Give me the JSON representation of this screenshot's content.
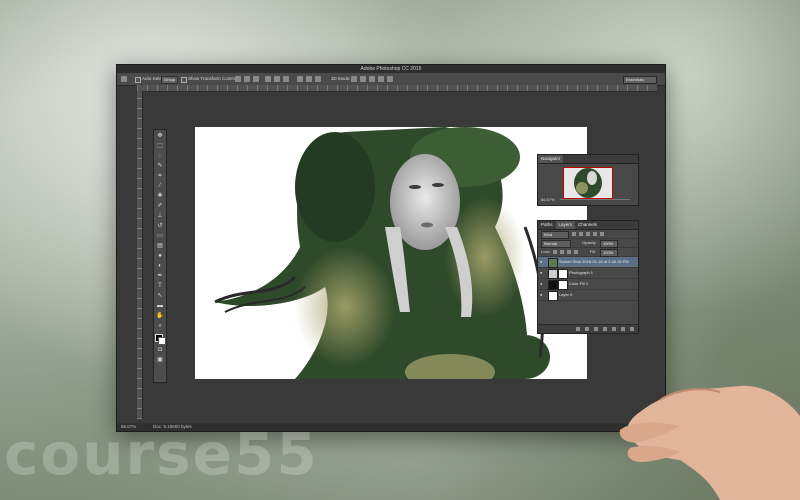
{
  "app": {
    "window_title": "Adobe Photoshop CC 2015"
  },
  "options_bar": {
    "auto_select_label": "Auto-Select:",
    "auto_select_value": "Group",
    "show_transform_label": "Show Transform Controls",
    "mode_3d_label": "3D Mode:",
    "workspace_value": "Essentials"
  },
  "toolbar": {
    "tools": [
      {
        "icon": "move-icon",
        "glyph": "✥"
      },
      {
        "icon": "marquee-icon",
        "glyph": "⬚"
      },
      {
        "icon": "lasso-icon",
        "glyph": "◌"
      },
      {
        "icon": "quick-select-icon",
        "glyph": "✎"
      },
      {
        "icon": "crop-icon",
        "glyph": "⌗"
      },
      {
        "icon": "eyedropper-icon",
        "glyph": "⁄"
      },
      {
        "icon": "healing-icon",
        "glyph": "✚"
      },
      {
        "icon": "brush-icon",
        "glyph": "✐"
      },
      {
        "icon": "clone-stamp-icon",
        "glyph": "⊥"
      },
      {
        "icon": "history-brush-icon",
        "glyph": "↺"
      },
      {
        "icon": "eraser-icon",
        "glyph": "▭"
      },
      {
        "icon": "gradient-icon",
        "glyph": "▤"
      },
      {
        "icon": "blur-icon",
        "glyph": "●"
      },
      {
        "icon": "dodge-icon",
        "glyph": "◐"
      },
      {
        "icon": "pen-icon",
        "glyph": "✒"
      },
      {
        "icon": "type-icon",
        "glyph": "T"
      },
      {
        "icon": "path-select-icon",
        "glyph": "↖"
      },
      {
        "icon": "shape-icon",
        "glyph": "▬"
      },
      {
        "icon": "hand-icon",
        "glyph": "✋"
      },
      {
        "icon": "zoom-icon",
        "glyph": "⌕"
      }
    ]
  },
  "navigator": {
    "tab": "Navigator",
    "zoom": "66.67%"
  },
  "layers_panel": {
    "tabs": [
      "Paths",
      "Layers",
      "Channels"
    ],
    "active_tab": "Layers",
    "kind_label": "Kind",
    "blend_mode": "Normal",
    "opacity_label": "Opacity:",
    "opacity_value": "100%",
    "lock_label": "Lock:",
    "fill_label": "Fill:",
    "fill_value": "100%",
    "layers": [
      {
        "name": "Screen Shot 2016-01-18 at 3.46.15 PM",
        "selected": true,
        "thumb": "#5d7a52",
        "has_mask": false
      },
      {
        "name": "Photograph 1",
        "selected": false,
        "thumb": "#cfcfcf",
        "has_mask": true
      },
      {
        "name": "Color Fill 1",
        "selected": false,
        "thumb": "#111111",
        "has_mask": true
      },
      {
        "name": "Layer 0",
        "selected": false,
        "thumb": "#ffffff",
        "has_mask": false
      }
    ]
  },
  "status_bar": {
    "zoom": "66.67%",
    "doc_info": "Doc: 5.15M/0 bytes"
  },
  "watermark": "course55",
  "colors": {
    "ps_background": "#393939",
    "panel": "#484848",
    "selected_layer": "#5b6f86",
    "forest_green": "#3e5a36",
    "fog_olive": "#a3a06a"
  }
}
